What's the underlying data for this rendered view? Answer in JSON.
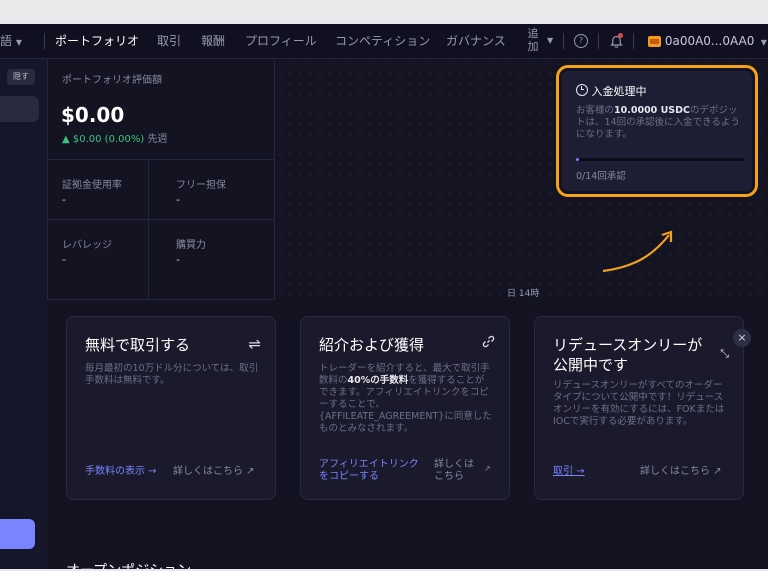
{
  "nav": {
    "lang": "語",
    "items": [
      "ポートフォリオ",
      "取引",
      "報酬",
      "プロフィール",
      "コンペティション",
      "ガバナンス"
    ],
    "add_line1": "追",
    "add_line2": "加",
    "help_icon": "?",
    "wallet": "0a00A0...0AA0"
  },
  "sidebar": {
    "hide_label": "隠す"
  },
  "portfolio": {
    "value_label": "ポートフォリオ評価額",
    "value": "$0.00",
    "change": "▲ $0.00 (0.00%)",
    "change_period": "先週",
    "margin_usage_label": "証拠金使用率",
    "margin_usage_value": "-",
    "free_collateral_label": "フリー担保",
    "free_collateral_value": "-",
    "leverage_label": "レバレッジ",
    "leverage_value": "-",
    "buying_power_label": "購買力",
    "buying_power_value": "-"
  },
  "chart": {
    "x_tick": "日 14時"
  },
  "deposit": {
    "title": "入金処理中",
    "body_pre": "お客様の",
    "body_amount": "10.0000 USDC",
    "body_post": "のデポジットは、14回の承認後に入金できるようになります。",
    "progress_fraction": 0.02,
    "count": "0/14回承認"
  },
  "cards": {
    "free_trade": {
      "title": "無料で取引する",
      "icon": "⇌",
      "body": "毎月最初の10万ドル分については、取引手数料は無料です。",
      "link": "手数料の表示 →",
      "more": "詳しくはこちら ↗"
    },
    "referral": {
      "title": "紹介および獲得",
      "icon": "🔗",
      "body_pre": "トレーダーを紹介すると、最大で取引手数料の",
      "body_bold": "40%の手数料",
      "body_post": "を獲得することができます。アフィリエイトリンクをコピーすることで、{AFFILEATE_AGREEMENT}に同意したものとみなされます。",
      "link_line1": "アフィリエイトリンク",
      "link_line2": "をコピーする",
      "more_line1": "詳しくは",
      "more_line2": "こちら",
      "more_icon": "↗"
    },
    "reduce_only": {
      "title_line1": "リデュースオンリーが",
      "title_line2": "公開中です",
      "icon": "⤡",
      "body": "リデュースオンリーがすべてのオーダータイプについて公開中です！リデュースオンリーを有効にするには、FOKまたはIOCで実行する必要があります。",
      "link": "取引 →",
      "more": "詳しくはこちら ↗"
    },
    "close_icon": "×"
  },
  "open_positions": {
    "title": "オープンポジション"
  },
  "colors": {
    "accent": "#7a84ff",
    "highlight": "#f5a21b",
    "positive": "#3ac47d"
  }
}
